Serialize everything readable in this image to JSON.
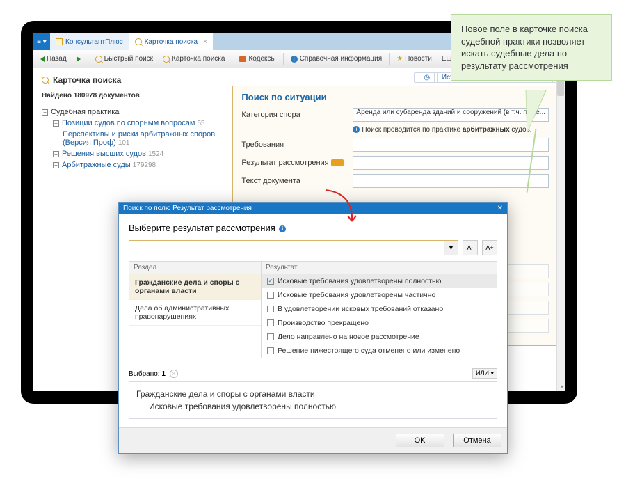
{
  "tabs": {
    "home": "КонсультантПлюс",
    "search": "Карточка поиска"
  },
  "toolbar": {
    "back": "Назад",
    "quick_search": "Быстрый поиск",
    "card_search": "Карточка поиска",
    "codex": "Кодексы",
    "ref_info": "Справочная информация",
    "news": "Новости",
    "more": "Еще"
  },
  "page": {
    "title": "Карточка поиска",
    "found_label": "Найдено 180978 документов",
    "history_link": "История и сохраненные запросы"
  },
  "tree": {
    "root": "Судебная практика",
    "items": [
      {
        "label": "Позиции судов по спорным вопросам",
        "count": "55"
      },
      {
        "label": "Перспективы и риски арбитражных споров (Версия Проф)",
        "count": "101"
      },
      {
        "label": "Решения высших судов",
        "count": "1524"
      },
      {
        "label": "Арбитражные суды",
        "count": "179298"
      }
    ]
  },
  "panel": {
    "title": "Поиск по ситуации",
    "fields": {
      "category_label": "Категория спора",
      "category_value": "Аренда или субаренда зданий и сооружений (в т.ч. поме...",
      "hint_prefix": "Поиск проводится по практике ",
      "hint_bold": "арбитражных",
      "hint_suffix": " судов.",
      "claims_label": "Требования",
      "result_label": "Результат рассмотрения",
      "text_label": "Текст документа"
    }
  },
  "dialog": {
    "title": "Поиск по полю Результат рассмотрения",
    "heading": "Выберите результат рассмотрения",
    "col_section": "Раздел",
    "col_result": "Результат",
    "sections": [
      "Гражданские дела и споры с органами власти",
      "Дела об административных правонарушениях"
    ],
    "results": [
      "Исковые требования удовлетворены полностью",
      "Исковые требования удовлетворены частично",
      "В удовлетворении исковых требований отказано",
      "Производство прекращено",
      "Дело направлено на новое рассмотрение",
      "Решение нижестоящего суда отменено или изменено"
    ],
    "font_smaller": "A-",
    "font_larger": "A+",
    "selected_label": "Выбрано:",
    "selected_count": "1",
    "logic": "ИЛИ",
    "sel_line1": "Гражданские дела и споры с органами власти",
    "sel_line2": "Исковые требования удовлетворены полностью",
    "ok": "OK",
    "cancel": "Отмена"
  },
  "callout": {
    "text": "Новое поле в карточке поиска судебной практики позволяет искать судебные дела по результату рассмотрения"
  }
}
